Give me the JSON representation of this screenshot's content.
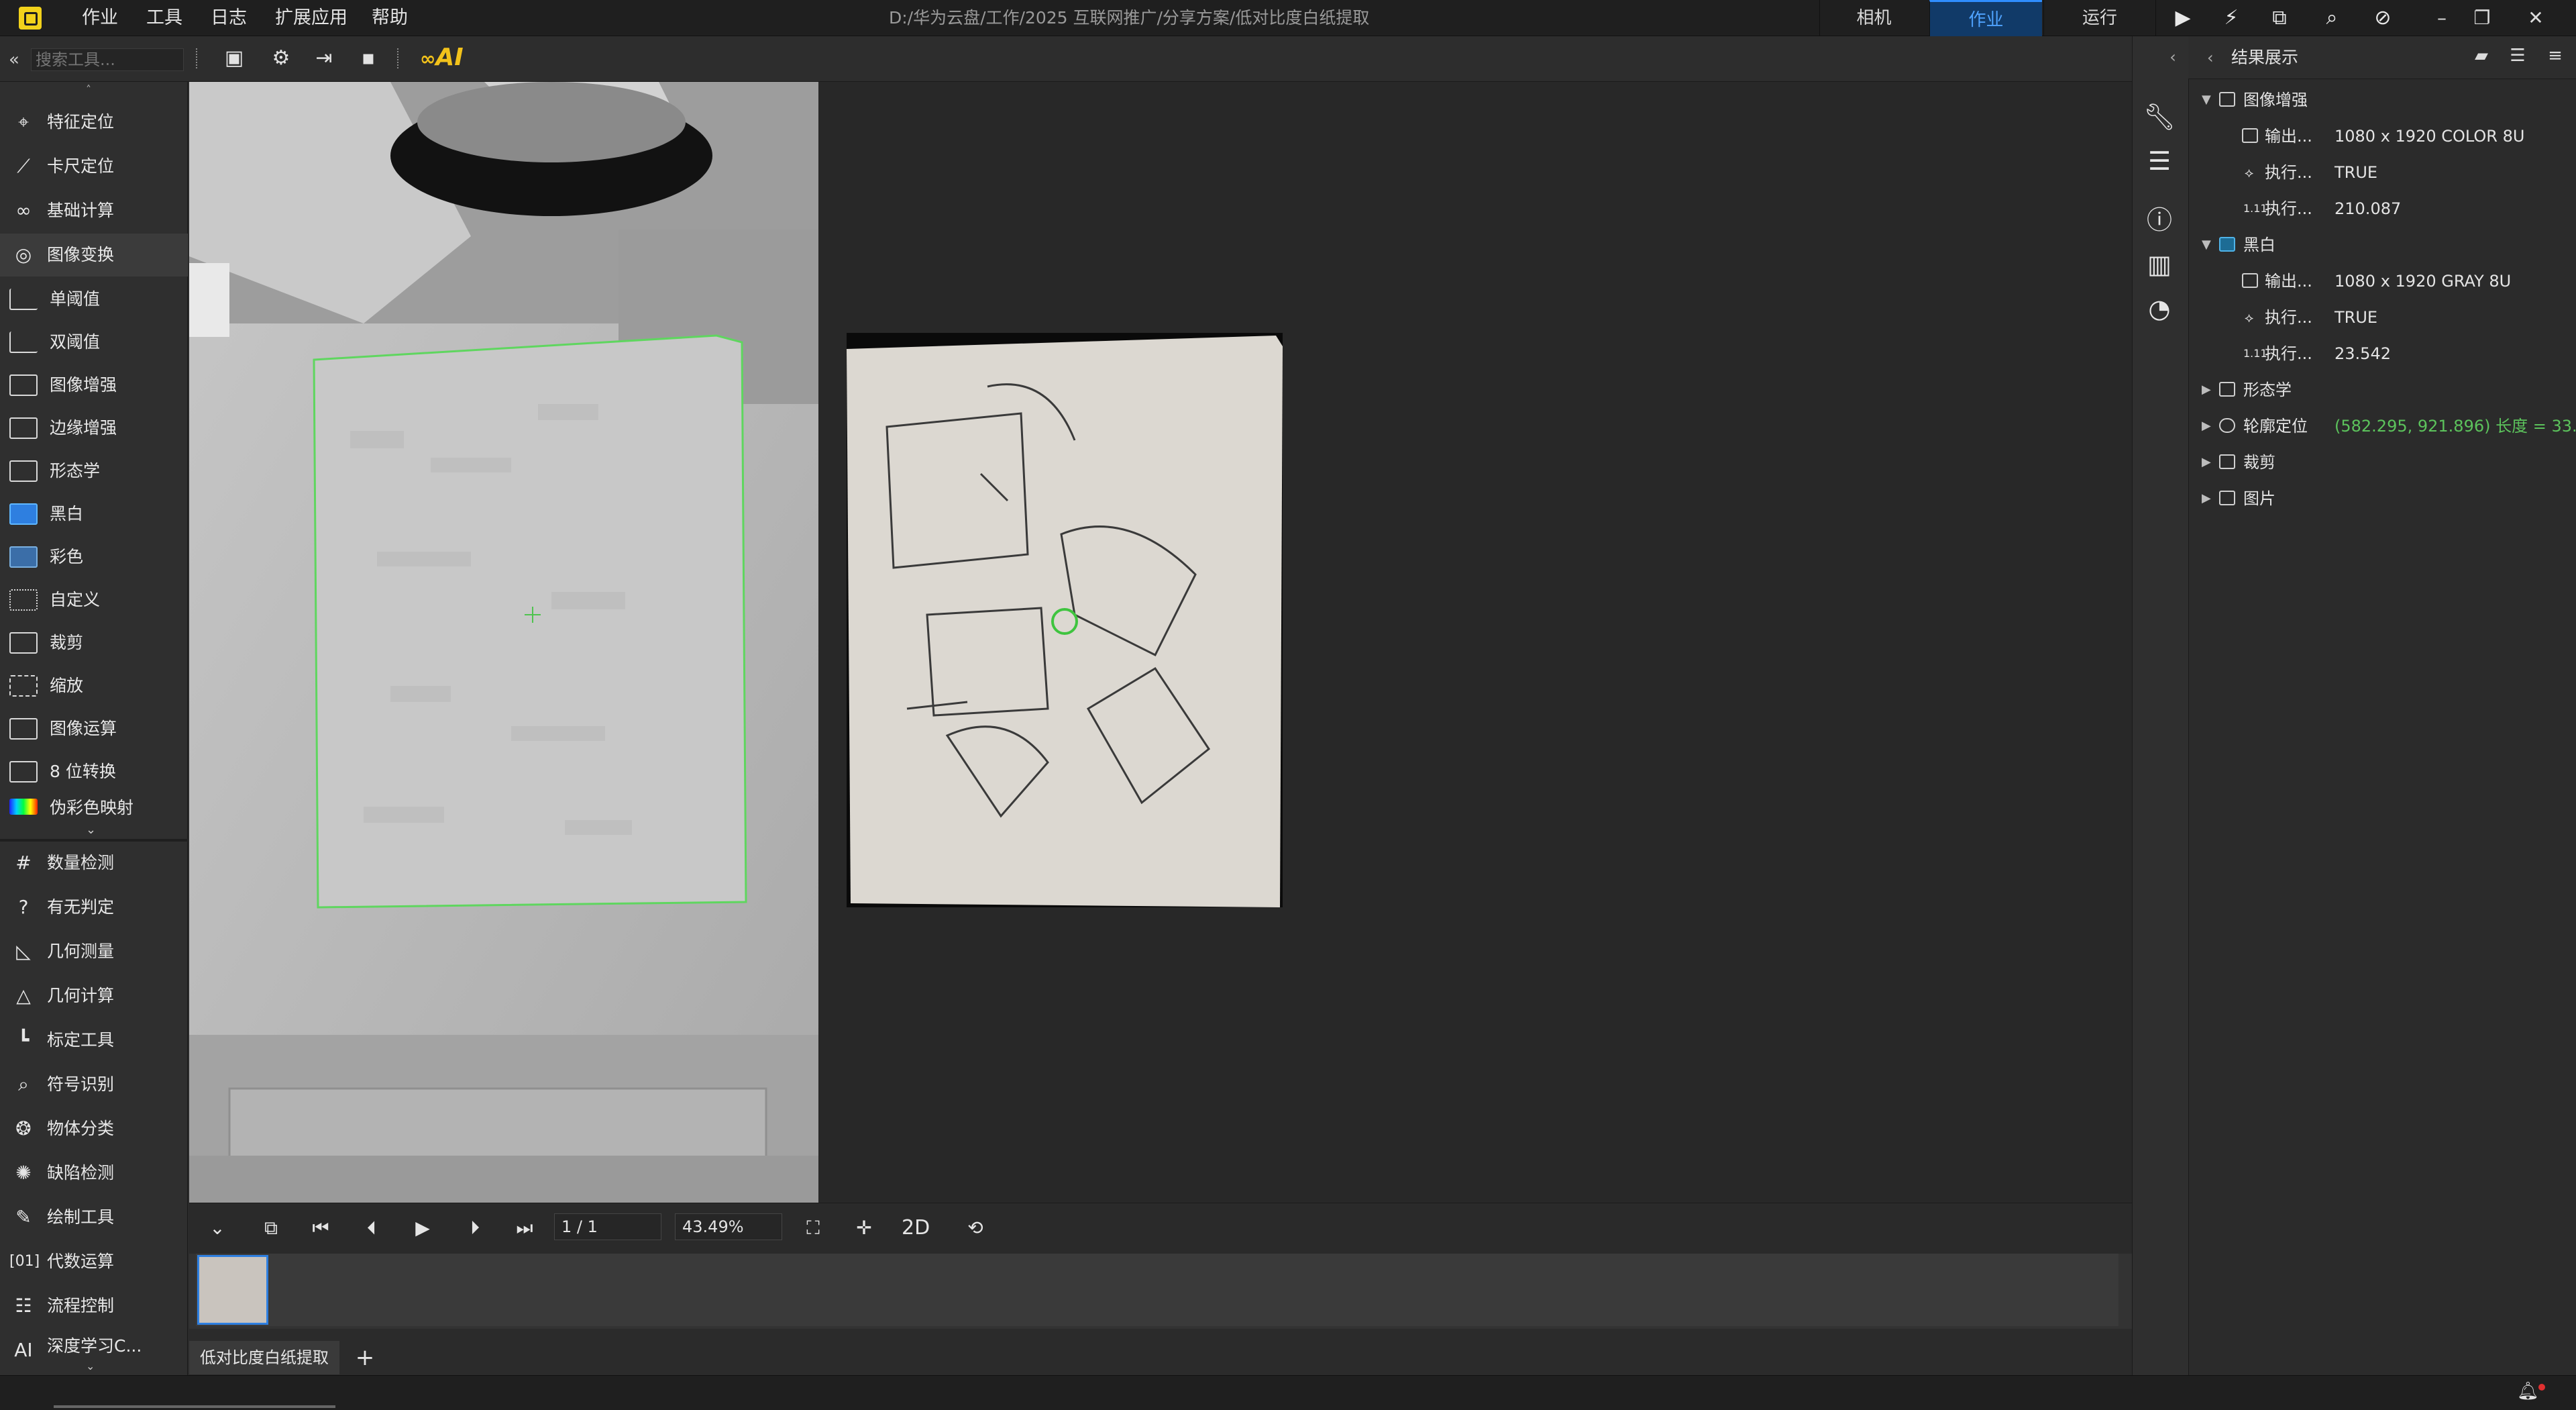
{
  "titlebar": {
    "menu": [
      "作业",
      "工具",
      "日志",
      "扩展应用",
      "帮助"
    ],
    "path": "D:/华为云盘/工作/2025 互联网推广/分享方案/低对比度白纸提取",
    "mode_tabs": [
      "相机",
      "作业",
      "运行"
    ],
    "active_mode": "作业"
  },
  "toolbar": {
    "search_placeholder": "搜索工具...",
    "ai_label": "AI"
  },
  "sidebar": {
    "top_items": [
      "特征定位",
      "卡尺定位",
      "基础计算",
      "图像变换"
    ],
    "sub_items": [
      "单阈值",
      "双阈值",
      "图像增强",
      "边缘增强",
      "形态学",
      "黑白",
      "彩色",
      "自定义",
      "裁剪",
      "缩放",
      "图像运算",
      "8 位转换",
      "伪彩色映射"
    ],
    "bottom_items": [
      "数量检测",
      "有无判定",
      "几何测量",
      "几何计算",
      "标定工具",
      "符号识别",
      "物体分类",
      "缺陷检测",
      "绘制工具",
      "代数运算",
      "流程控制",
      "深度学习C..."
    ]
  },
  "player": {
    "page": "1 / 1",
    "zoom": "43.49%",
    "mode_2d": "2D"
  },
  "bottom_tabs": {
    "flow_name": "低对比度白纸提取",
    "add": "+"
  },
  "results": {
    "title": "结果展示",
    "tree": [
      {
        "label": "图像增强",
        "level": 0,
        "expanded": true
      },
      {
        "label": "输出...",
        "level": 1,
        "value": "1080 x 1920 COLOR 8U"
      },
      {
        "label": "执行...",
        "level": 1,
        "value": "TRUE"
      },
      {
        "label": "执行...",
        "level": 1,
        "value": "210.087"
      },
      {
        "label": "黑白",
        "level": 0,
        "expanded": true
      },
      {
        "label": "输出...",
        "level": 1,
        "value": "1080 x 1920 GRAY 8U"
      },
      {
        "label": "执行...",
        "level": 1,
        "value": "TRUE"
      },
      {
        "label": "执行...",
        "level": 1,
        "value": "23.542"
      },
      {
        "label": "形态学",
        "level": 0,
        "expanded": false
      },
      {
        "label": "轮廓定位",
        "level": 0,
        "expanded": false,
        "value": "(582.295, 921.896) 长度 = 33..."
      },
      {
        "label": "裁剪",
        "level": 0,
        "expanded": false
      },
      {
        "label": "图片",
        "level": 0,
        "expanded": false
      }
    ],
    "highlight_color": "#5cc35c"
  }
}
